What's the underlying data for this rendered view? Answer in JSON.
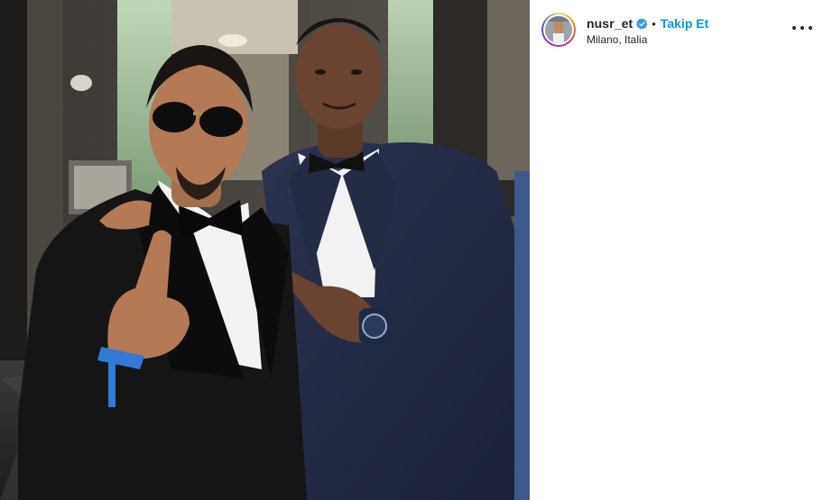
{
  "post": {
    "image_alt": "Two men in tuxedos posing for a photo",
    "header": {
      "username": "nusr_et",
      "verified": true,
      "separator": "•",
      "follow_label": "Takip Et",
      "location": "Milano, Italia"
    },
    "colors": {
      "follow": "#0095f6",
      "verified_badge": "#3897f0",
      "text": "#262626"
    },
    "icons": {
      "verified": "verified-badge-icon",
      "more": "more-options-icon"
    }
  }
}
